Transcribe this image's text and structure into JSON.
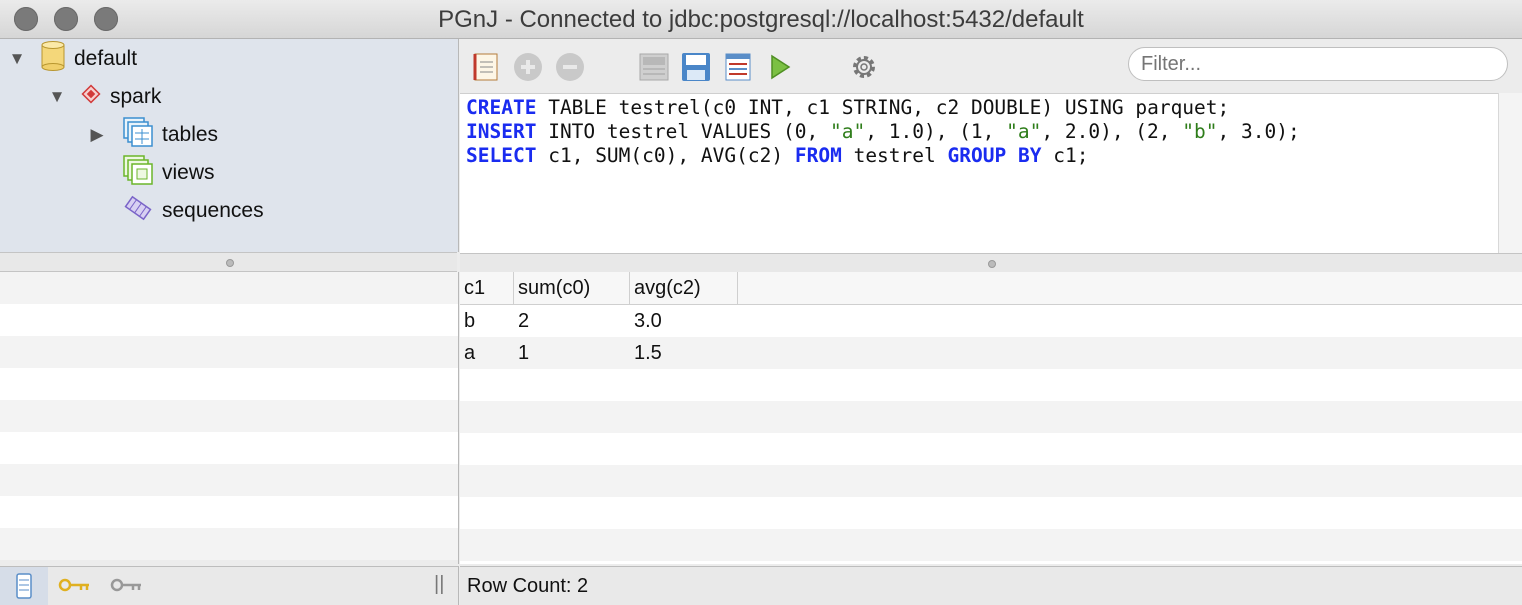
{
  "window": {
    "title": "PGnJ - Connected to jdbc:postgresql://localhost:5432/default"
  },
  "tree": {
    "database": "default",
    "schema": "spark",
    "items": [
      {
        "label": "tables",
        "icon": "tables-icon"
      },
      {
        "label": "views",
        "icon": "views-icon"
      },
      {
        "label": "sequences",
        "icon": "sequences-icon"
      }
    ]
  },
  "toolbar": {
    "icons": [
      "notebook-icon",
      "add-icon",
      "remove-icon",
      "sql-icon",
      "save-icon",
      "list-icon",
      "run-icon",
      "settings-icon"
    ],
    "filter_placeholder": "Filter..."
  },
  "editor": {
    "lines": [
      "CREATE TABLE testrel(c0 INT, c1 STRING, c2 DOUBLE) USING parquet;",
      "INSERT INTO testrel VALUES (0, \"a\", 1.0), (1, \"a\", 2.0), (2, \"b\", 3.0);",
      "SELECT c1, SUM(c0), AVG(c2) FROM testrel GROUP BY c1;"
    ]
  },
  "results": {
    "columns": [
      "c1",
      "sum(c0)",
      "avg(c2)"
    ],
    "rows": [
      [
        "b",
        "2",
        "3.0"
      ],
      [
        "a",
        "1",
        "1.5"
      ]
    ]
  },
  "status": {
    "row_count": "Row Count: 2",
    "splitter_label": "||"
  },
  "colors": {
    "keyword": "#1a2cf0",
    "string": "#2e7d1a",
    "tree_bg": "#dfe4ec"
  }
}
